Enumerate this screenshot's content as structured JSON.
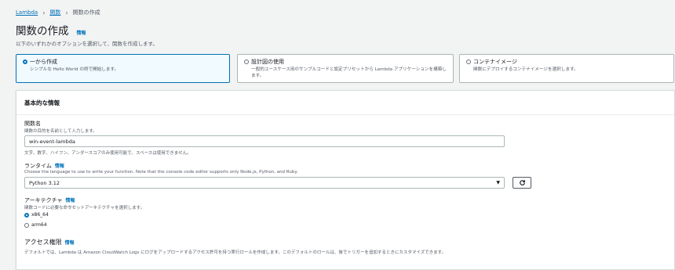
{
  "breadcrumb": {
    "root": "Lambda",
    "parent": "関数",
    "current": "関数の作成"
  },
  "page": {
    "title": "関数の作成",
    "info": "情報",
    "description": "以下のいずれかのオプションを選択して、関数を作成します。"
  },
  "options": [
    {
      "title": "一から作成",
      "desc": "シンプルな Hello World の例で開始します。",
      "selected": true
    },
    {
      "title": "設計図の使用",
      "desc": "一般的ユースケース用のサンプルコードと設定プリセットから Lambda アプリケーションを構築します。",
      "selected": false
    },
    {
      "title": "コンテナイメージ",
      "desc": "関数にデプロイするコンテナイメージを選択します。",
      "selected": false
    }
  ],
  "basic": {
    "header": "基本的な情報",
    "function_name": {
      "label": "関数名",
      "desc": "関数の目的を名前として入力します。",
      "value": "win-event-lambda",
      "hint": "文字、数字、ハイフン、アンダースコアのみ使用可能で、スペースは使用できません。"
    },
    "runtime": {
      "label": "ランタイム",
      "info": "情報",
      "desc": "Choose the language to use to write your function. Note that the console code editor supports only Node.js, Python, and Ruby.",
      "value": "Python 3.12"
    },
    "architecture": {
      "label": "アーキテクチャ",
      "info": "情報",
      "desc": "関数コードに必要な命令セットアーキテクチャを選択します。",
      "options": [
        "x86_64",
        "arm64"
      ],
      "selected": "x86_64"
    },
    "permissions": {
      "label": "アクセス権限",
      "info": "情報",
      "desc": "デフォルトでは、Lambda は Amazon CloudWatch Logs にログをアップロードするアクセス許可を持つ実行ロールを作成します。このデフォルトのロールは、後でトリガーを追加するときにカスタマイズできます。"
    }
  },
  "colors": {
    "accent": "#0073bb",
    "link": "#0073bb",
    "background": "#f2f3f3",
    "selected_bg": "#f1faff"
  }
}
